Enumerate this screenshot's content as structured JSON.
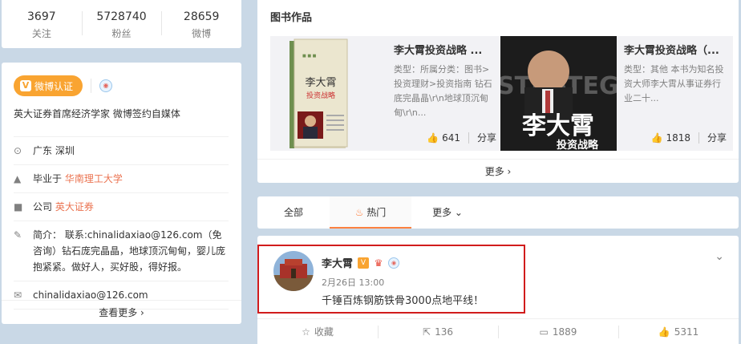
{
  "stats": [
    {
      "num": "3697",
      "label": "关注"
    },
    {
      "num": "5728740",
      "label": "粉丝"
    },
    {
      "num": "28659",
      "label": "微博"
    }
  ],
  "profile": {
    "verify_label": "微博认证",
    "verify_v": "V",
    "bio": "英大证券首席经济学家 微博签约自媒体",
    "location": "广东 深圳",
    "edu_prefix": "毕业于",
    "edu_link": "华南理工大学",
    "company_prefix": "公司",
    "company_link": "英大证券",
    "intro": "简介： 联系:chinalidaxiao@126.com（免咨询）钻石庞完晶晶，地球顶沉甸甸，婴儿庞抱紧紧。做好人，买好股，得好报。",
    "email": "chinalidaxiao@126.com",
    "more": "查看更多 ›"
  },
  "books": {
    "title": "图书作品",
    "items": [
      {
        "title": "李大霄投资战略 ...",
        "desc": "类型：所属分类：图书>投资理财>投资指南 钻石底完晶晶\\r\\n地球顶沉甸甸\\r\\n...",
        "likes": "641",
        "share": "分享"
      },
      {
        "title": "李大霄投资战略（...",
        "desc": "类型：其他 本书为知名投资大师李大霄从事证券行业二十...",
        "likes": "1818",
        "share": "分享"
      }
    ],
    "more": "更多 ›"
  },
  "tabs": {
    "all": "全部",
    "hot": "热门",
    "more": "更多 ⌄"
  },
  "post": {
    "author": "李大霄",
    "time": "2月26日 13:00",
    "text": "千锤百炼钢筋铁骨3000点地平线！",
    "actions": [
      {
        "icon": "star-icon",
        "glyph": "☆",
        "label": "收藏"
      },
      {
        "icon": "repost-icon",
        "glyph": "⇱",
        "label": "136"
      },
      {
        "icon": "comment-icon",
        "glyph": "▭",
        "label": "1889"
      },
      {
        "icon": "like-icon",
        "glyph": "👍",
        "label": "5311"
      }
    ]
  },
  "colors": {
    "verify": "#f9a431",
    "link": "#eb7350",
    "highlight": "#d11c1c",
    "tab_active": "#ff8140"
  },
  "book_cover_text": {
    "b1_name": "李大霄",
    "b1_sub": "投资战略",
    "b2_big": "李大霄",
    "b2_sub": "投资战略",
    "b2_en": "STRATEGY"
  }
}
